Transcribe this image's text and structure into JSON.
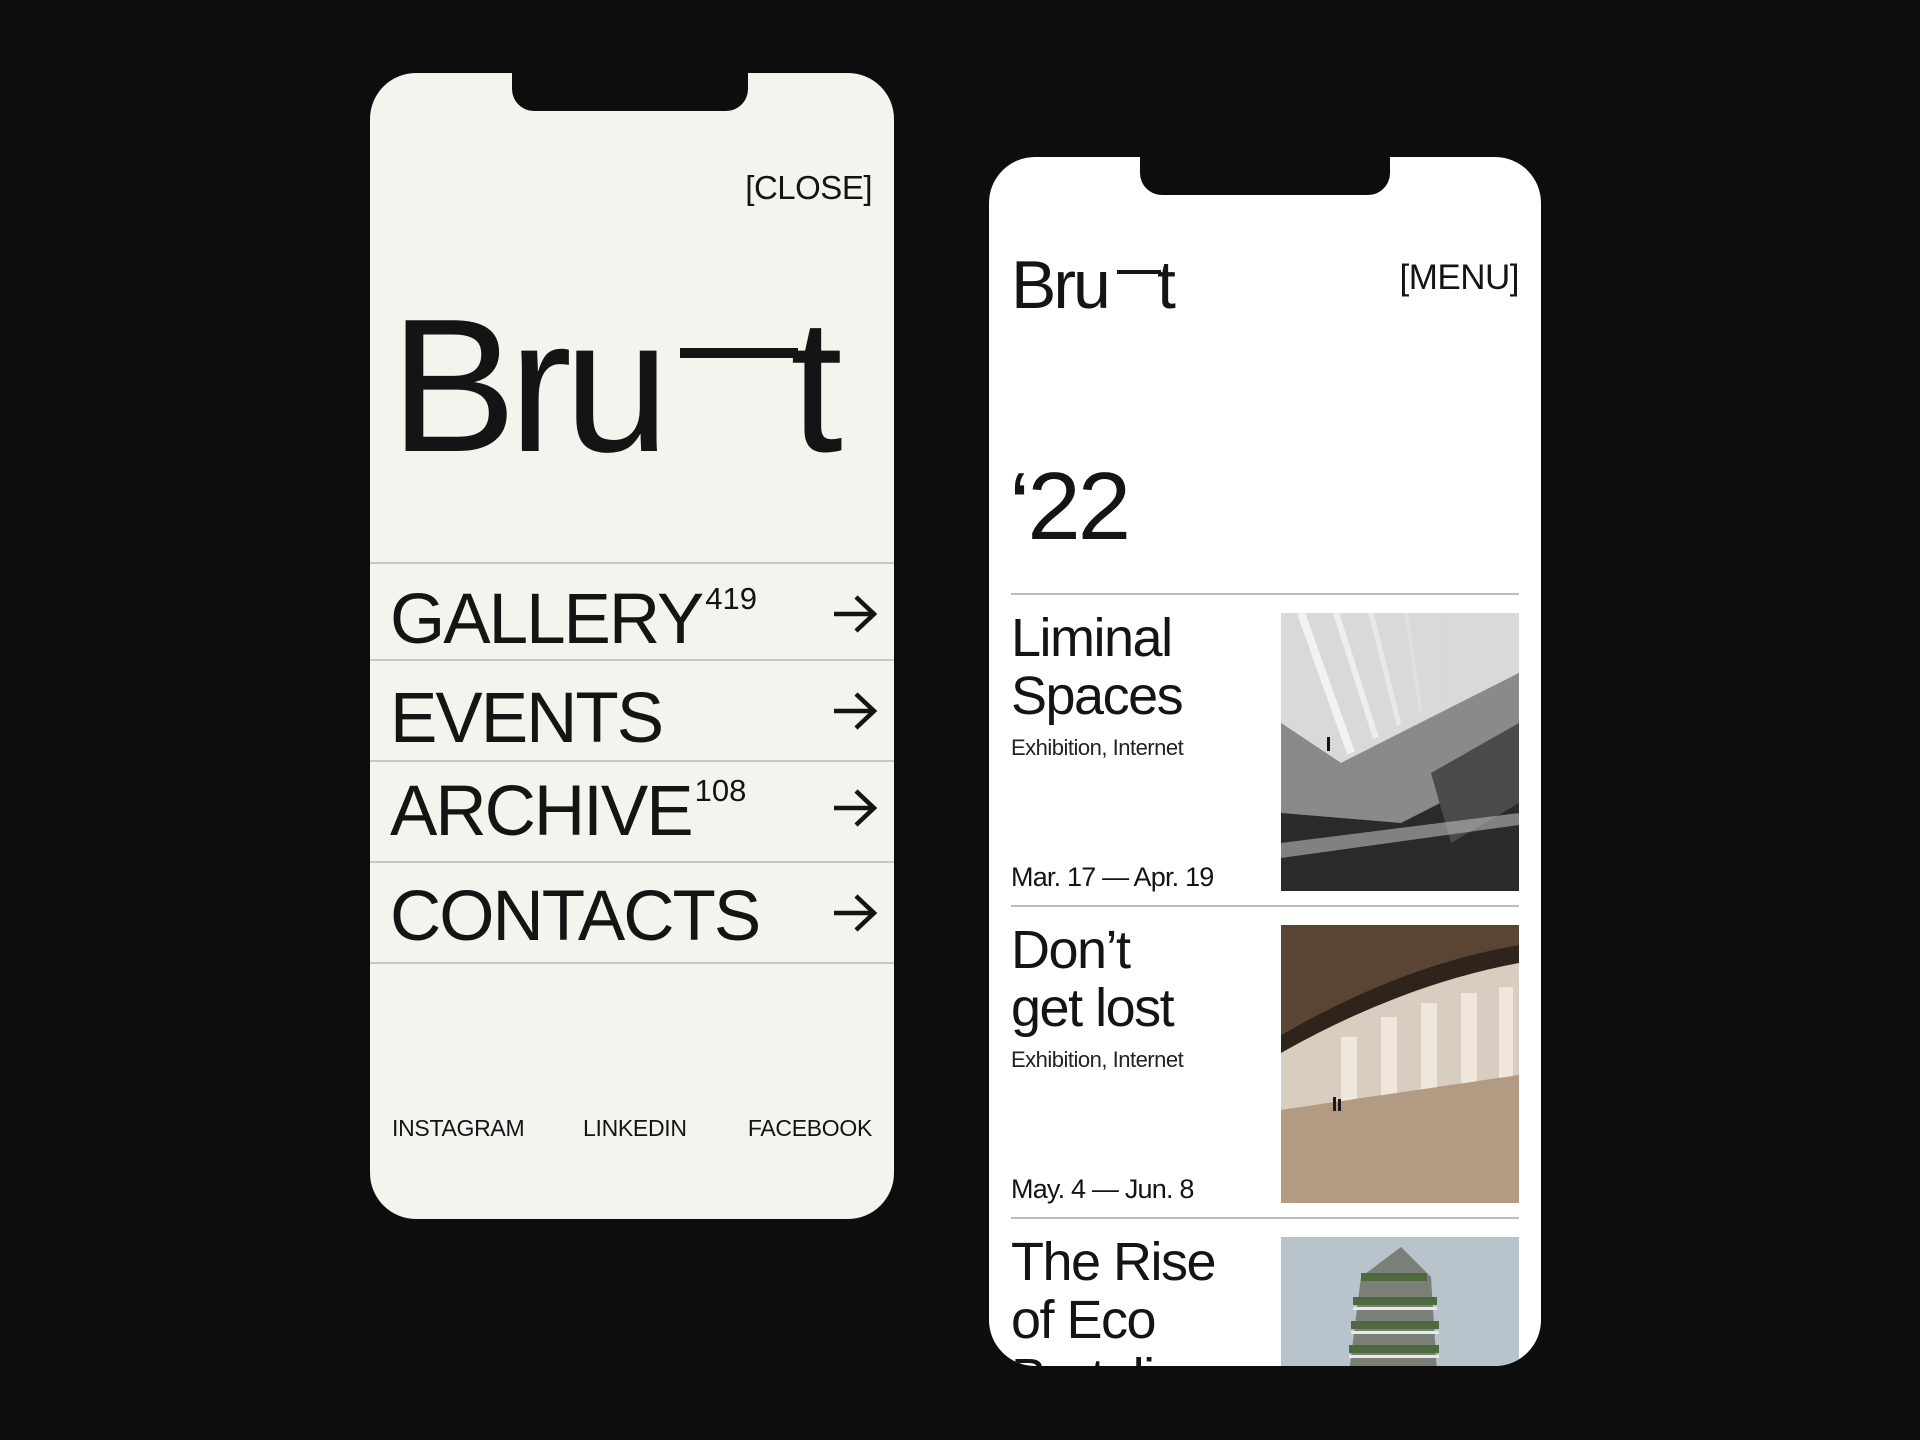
{
  "menu_screen": {
    "close_label": "[CLOSE]",
    "logo_text": "Bru—t",
    "items": [
      {
        "label": "GALLERY",
        "count": "419"
      },
      {
        "label": "EVENTS",
        "count": ""
      },
      {
        "label": "ARCHIVE",
        "count": "108"
      },
      {
        "label": "CONTACTS",
        "count": ""
      }
    ],
    "arrow_icon": "arrow-right-icon",
    "social": {
      "instagram": "INSTAGRAM",
      "linkedin": "LINKEDIN",
      "facebook": "FACEBOOK"
    },
    "colors": {
      "background": "#f5f3ee",
      "text": "#141414",
      "divider": "#c9c7c2"
    }
  },
  "home_screen": {
    "logo_text": "Bru—t",
    "menu_label": "[MENU]",
    "year": "‘22",
    "cards": [
      {
        "title_line1": "Liminal",
        "title_line2": "Spaces",
        "title_line3": "",
        "tags": "Exhibition, Internet",
        "dates": "Mar. 17 — Apr. 19"
      },
      {
        "title_line1": "Don’t",
        "title_line2": "get lost",
        "title_line3": "",
        "tags": "Exhibition, Internet",
        "dates": "May. 4 — Jun. 8"
      },
      {
        "title_line1": "The Rise",
        "title_line2": "of Eco",
        "title_line3": "Brutalism",
        "tags": "",
        "dates": ""
      }
    ],
    "colors": {
      "background": "#ffffff",
      "text": "#141414",
      "divider": "#bdbdbd"
    }
  },
  "page": {
    "background": "#0d0d0d"
  }
}
